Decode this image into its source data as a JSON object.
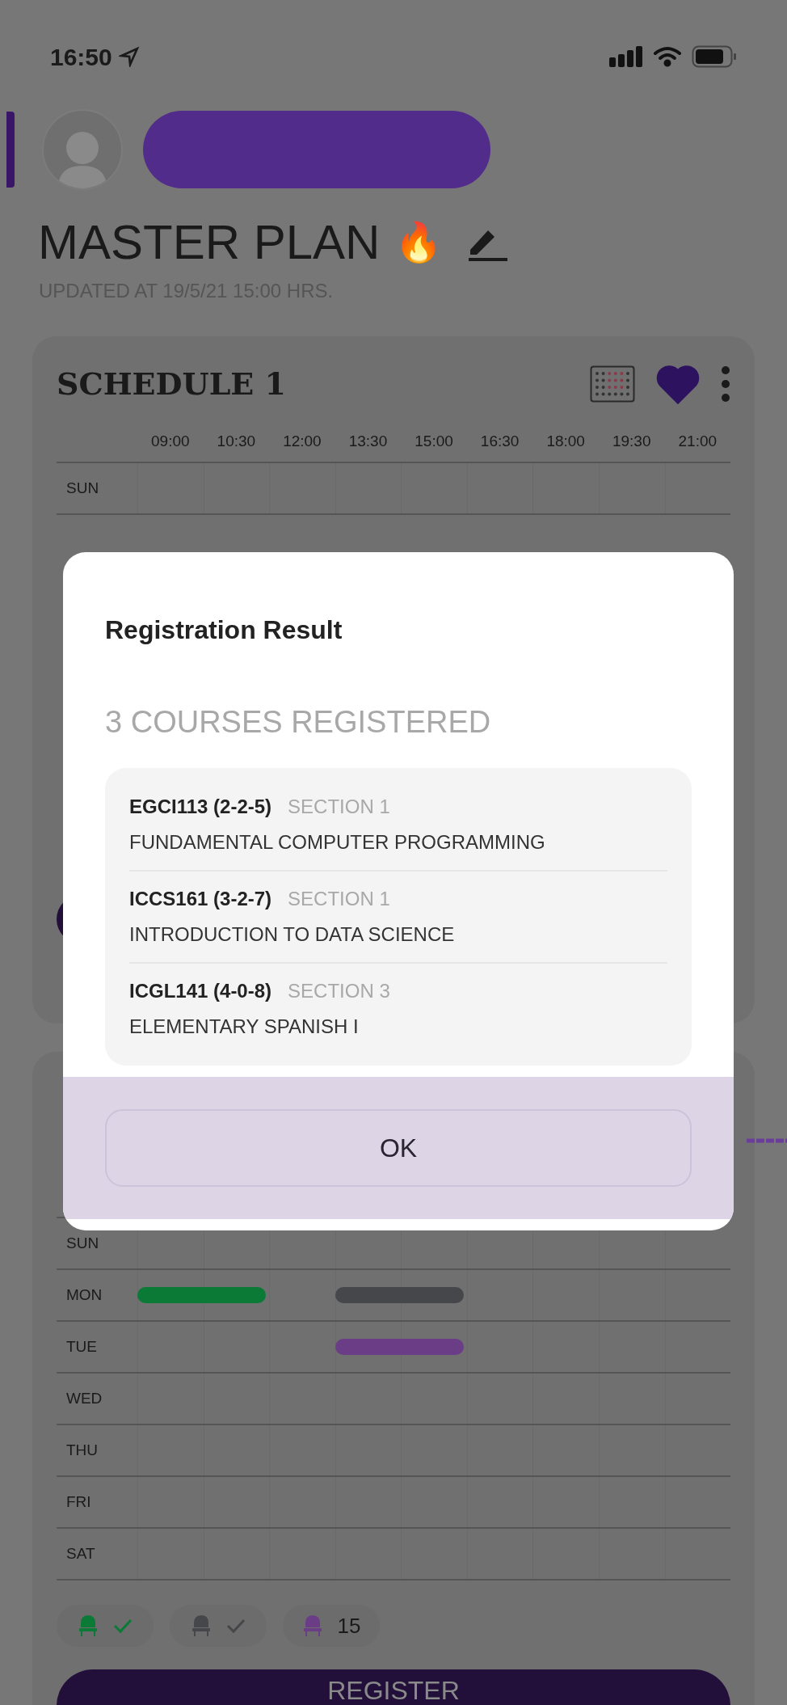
{
  "status_bar": {
    "time": "16:50"
  },
  "header": {
    "title": "MASTER PLAN",
    "emoji": "🔥",
    "updated": "UPDATED AT 19/5/21 15:00 HRS."
  },
  "times": [
    "09:00",
    "10:30",
    "12:00",
    "13:30",
    "15:00",
    "16:30",
    "18:00",
    "19:30",
    "21:00"
  ],
  "schedules": [
    {
      "title": "SCHEDULE 1",
      "favorite": true,
      "rows": [
        {
          "day": "SUN",
          "cells": [
            {
              "filled": false
            },
            {
              "filled": false
            },
            {
              "filled": false
            },
            {
              "filled": false
            },
            {
              "filled": false
            },
            {
              "filled": false
            },
            {
              "filled": false
            },
            {
              "filled": false
            },
            {
              "filled": false
            }
          ]
        }
      ]
    },
    {
      "rows": [
        {
          "day": "SUN",
          "cells": [
            {
              "filled": false
            },
            {
              "filled": false
            },
            {
              "filled": false
            },
            {
              "filled": false
            },
            {
              "filled": false
            },
            {
              "filled": false
            },
            {
              "filled": false
            },
            {
              "filled": false
            },
            {
              "filled": false
            }
          ]
        },
        {
          "day": "MON",
          "cells": [
            {
              "filled": true,
              "color": "#0b7a36"
            },
            {
              "filled": true,
              "color": "#0b7a36"
            },
            {
              "filled": false
            },
            {
              "filled": true,
              "color": "#45474a"
            },
            {
              "filled": true,
              "color": "#45474a"
            },
            {
              "filled": false
            },
            {
              "filled": false
            },
            {
              "filled": false
            },
            {
              "filled": false
            }
          ]
        },
        {
          "day": "TUE",
          "cells": [
            {
              "filled": false
            },
            {
              "filled": false
            },
            {
              "filled": false
            },
            {
              "filled": true,
              "color": "#6a3d86"
            },
            {
              "filled": true,
              "color": "#6a3d86"
            },
            {
              "filled": false
            },
            {
              "filled": false
            },
            {
              "filled": false
            },
            {
              "filled": false
            }
          ]
        },
        {
          "day": "WED",
          "cells": [
            {
              "filled": false
            },
            {
              "filled": false
            },
            {
              "filled": false
            },
            {
              "filled": false
            },
            {
              "filled": false
            },
            {
              "filled": false
            },
            {
              "filled": false
            },
            {
              "filled": false
            },
            {
              "filled": false
            }
          ]
        },
        {
          "day": "THU",
          "cells": [
            {
              "filled": false
            },
            {
              "filled": false
            },
            {
              "filled": false
            },
            {
              "filled": false
            },
            {
              "filled": false
            },
            {
              "filled": false
            },
            {
              "filled": false
            },
            {
              "filled": false
            },
            {
              "filled": false
            }
          ]
        },
        {
          "day": "FRI",
          "cells": [
            {
              "filled": false
            },
            {
              "filled": false
            },
            {
              "filled": false
            },
            {
              "filled": false
            },
            {
              "filled": false
            },
            {
              "filled": false
            },
            {
              "filled": false
            },
            {
              "filled": false
            },
            {
              "filled": false
            }
          ]
        },
        {
          "day": "SAT",
          "cells": [
            {
              "filled": false
            },
            {
              "filled": false
            },
            {
              "filled": false
            },
            {
              "filled": false
            },
            {
              "filled": false
            },
            {
              "filled": false
            },
            {
              "filled": false
            },
            {
              "filled": false
            },
            {
              "filled": false
            }
          ]
        }
      ],
      "legend": [
        {
          "kind": "check",
          "color": "#0b7a36"
        },
        {
          "kind": "check",
          "color": "#45474a"
        },
        {
          "kind": "count",
          "color": "#6a3d86",
          "count": "15"
        }
      ],
      "button": "REGISTER"
    }
  ],
  "dialog": {
    "title": "Registration Result",
    "summary": "3 COURSES REGISTERED",
    "courses": [
      {
        "code": "EGCI113 (2-2-5)",
        "section": "SECTION 1",
        "name": "FUNDAMENTAL COMPUTER PROGRAMMING"
      },
      {
        "code": "ICCS161 (3-2-7)",
        "section": "SECTION 1",
        "name": "INTRODUCTION TO DATA SCIENCE"
      },
      {
        "code": "ICGL141 (4-0-8)",
        "section": "SECTION 3",
        "name": "ELEMENTARY SPANISH I"
      }
    ],
    "button": "OK"
  }
}
